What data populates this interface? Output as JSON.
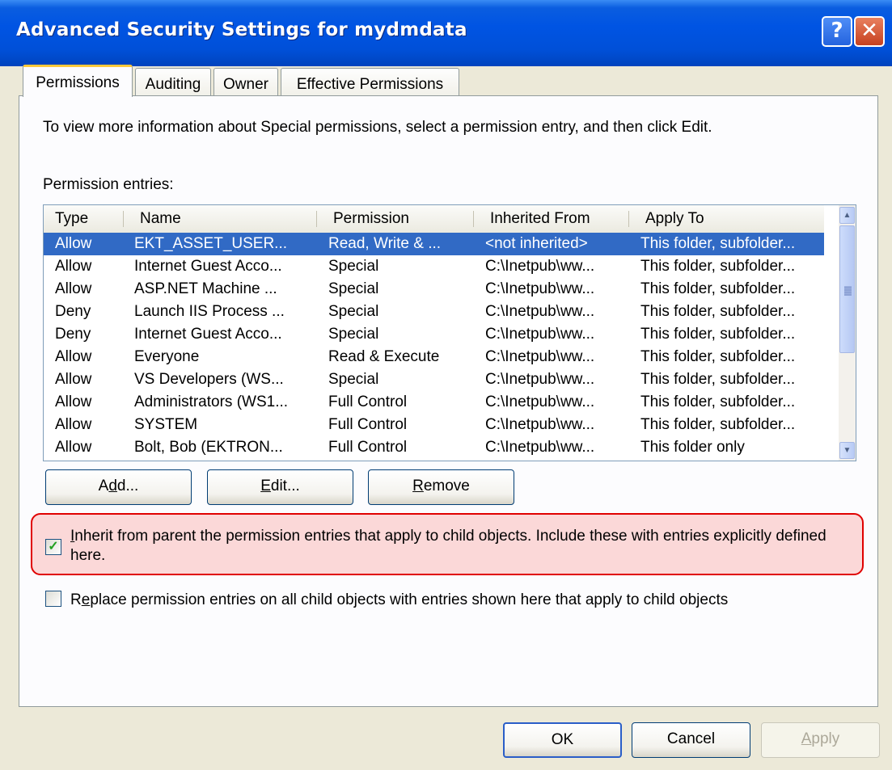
{
  "window": {
    "title": "Advanced Security Settings for mydmdata",
    "help_icon": "question-mark-icon",
    "close_icon": "close-x-icon"
  },
  "tabs": [
    {
      "label": "Permissions",
      "active": true
    },
    {
      "label": "Auditing",
      "active": false
    },
    {
      "label": "Owner",
      "active": false
    },
    {
      "label": "Effective Permissions",
      "active": false
    }
  ],
  "permissions": {
    "info_text": "To view more information about Special permissions, select a permission entry, and then click Edit.",
    "entries_label": "Permission entries:",
    "columns": [
      "Type",
      "Name",
      "Permission",
      "Inherited From",
      "Apply To"
    ],
    "rows": [
      {
        "type": "Allow",
        "name": "EKT_ASSET_USER...",
        "permission": "Read, Write & ...",
        "inherited": "<not inherited>",
        "apply": "This folder, subfolder...",
        "selected": true
      },
      {
        "type": "Allow",
        "name": "Internet Guest Acco...",
        "permission": "Special",
        "inherited": "C:\\Inetpub\\ww...",
        "apply": "This folder, subfolder..."
      },
      {
        "type": "Allow",
        "name": "ASP.NET Machine ...",
        "permission": "Special",
        "inherited": "C:\\Inetpub\\ww...",
        "apply": "This folder, subfolder..."
      },
      {
        "type": "Deny",
        "name": "Launch IIS Process ...",
        "permission": "Special",
        "inherited": "C:\\Inetpub\\ww...",
        "apply": "This folder, subfolder..."
      },
      {
        "type": "Deny",
        "name": "Internet Guest Acco...",
        "permission": "Special",
        "inherited": "C:\\Inetpub\\ww...",
        "apply": "This folder, subfolder..."
      },
      {
        "type": "Allow",
        "name": "Everyone",
        "permission": "Read & Execute",
        "inherited": "C:\\Inetpub\\ww...",
        "apply": "This folder, subfolder..."
      },
      {
        "type": "Allow",
        "name": "VS Developers (WS...",
        "permission": "Special",
        "inherited": "C:\\Inetpub\\ww...",
        "apply": "This folder, subfolder..."
      },
      {
        "type": "Allow",
        "name": "Administrators (WS1...",
        "permission": "Full Control",
        "inherited": "C:\\Inetpub\\ww...",
        "apply": "This folder, subfolder..."
      },
      {
        "type": "Allow",
        "name": "SYSTEM",
        "permission": "Full Control",
        "inherited": "C:\\Inetpub\\ww...",
        "apply": "This folder, subfolder..."
      },
      {
        "type": "Allow",
        "name": "Bolt, Bob (EKTRON...",
        "permission": "Full Control",
        "inherited": "C:\\Inetpub\\ww...",
        "apply": "This folder only"
      }
    ],
    "buttons": {
      "add": {
        "pre": "A",
        "key": "d",
        "post": "d..."
      },
      "edit": {
        "pre": "",
        "key": "E",
        "post": "dit..."
      },
      "remove": {
        "pre": "",
        "key": "R",
        "post": "emove"
      }
    },
    "inherit_checkbox": {
      "checked": true,
      "key": "I",
      "text_rest": "nherit from parent the permission entries that apply to child objects. Include these with entries explicitly defined here."
    },
    "replace_checkbox": {
      "checked": false,
      "pre": "R",
      "key": "e",
      "text_rest": "place permission entries on all child objects with entries shown here that apply to child objects"
    }
  },
  "footer": {
    "ok": "OK",
    "cancel": "Cancel",
    "apply": {
      "key": "A",
      "rest": "pply"
    }
  }
}
